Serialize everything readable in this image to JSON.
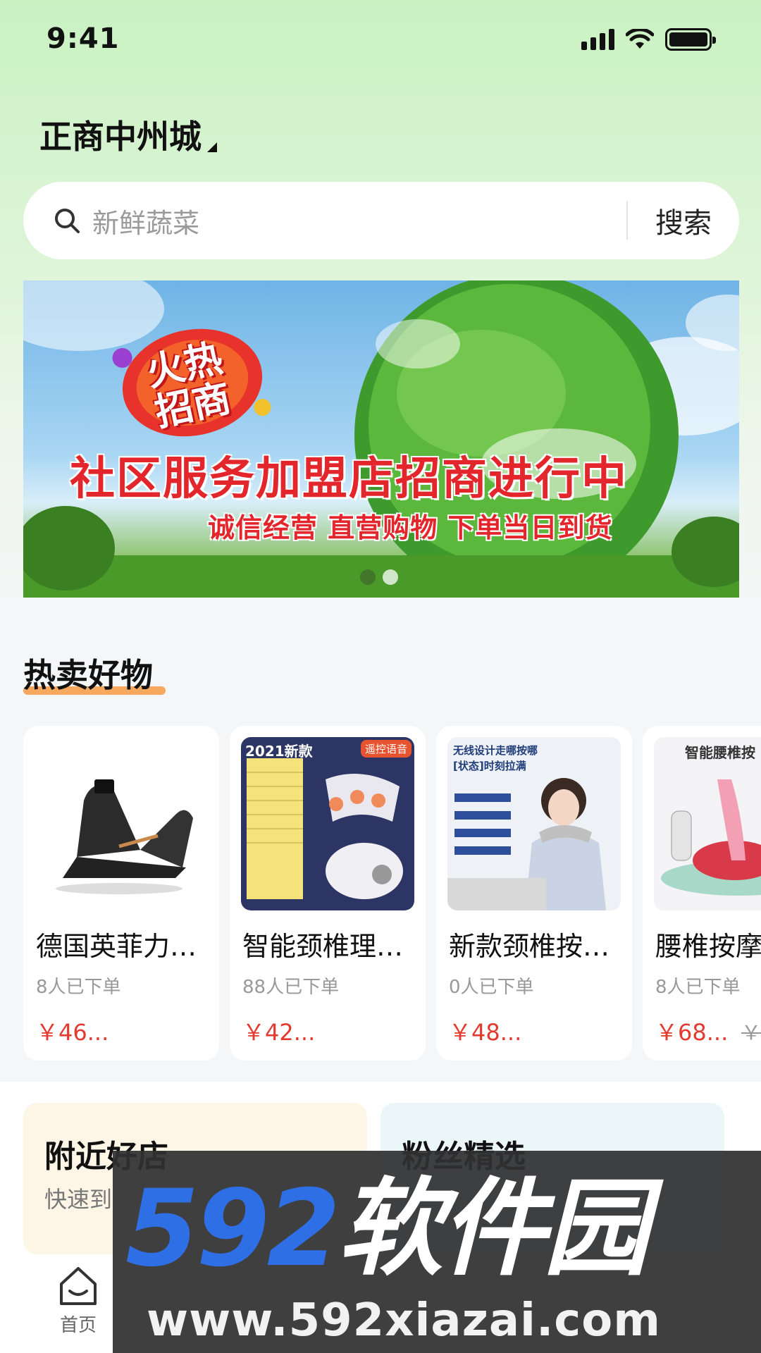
{
  "status_bar": {
    "time": "9:41"
  },
  "header": {
    "location": "正商中州城"
  },
  "search": {
    "placeholder": "新鲜蔬菜",
    "button_label": "搜索"
  },
  "banner": {
    "promo_line1": "火热",
    "promo_line2": "招商",
    "headline": "社区服务加盟店招商进行中",
    "subline": "诚信经营 直营购物 下单当日到货",
    "dot_count": 2,
    "active_dot": 2
  },
  "hot_section": {
    "title": "热卖好物",
    "products": [
      {
        "name": "德国英菲力…",
        "orders": "8人已下单",
        "price": "￥46...",
        "old_price": ""
      },
      {
        "name": "智能颈椎理…",
        "orders": "88人已下单",
        "price": "￥42...",
        "old_price": ""
      },
      {
        "name": "新款颈椎按…",
        "orders": "0人已下单",
        "price": "￥48...",
        "old_price": ""
      },
      {
        "name": "腰椎按摩",
        "orders": "8人已下单",
        "price": "￥68...",
        "old_price": "￥"
      }
    ],
    "product_image_text": {
      "p2_badge_year": "2021新款",
      "p2_badge_remote": "遥控语音",
      "p3_headline": "无线设计走哪按哪",
      "p3_subline": "[状态]时刻拉满",
      "p4_headline": "智能腰椎按"
    }
  },
  "features": [
    {
      "title": "附近好店",
      "subtitle": "快速到"
    },
    {
      "title": "粉丝精选",
      "subtitle": ""
    }
  ],
  "tabbar": {
    "home_label": "首页"
  },
  "watermark": {
    "logo_num": "592",
    "logo_cn": "软件园",
    "url": "www.592xiazai.com"
  },
  "colors": {
    "accent_price": "#e23a2e",
    "underline": "#f5a04c",
    "top_gradient": "#c9f1c2"
  }
}
